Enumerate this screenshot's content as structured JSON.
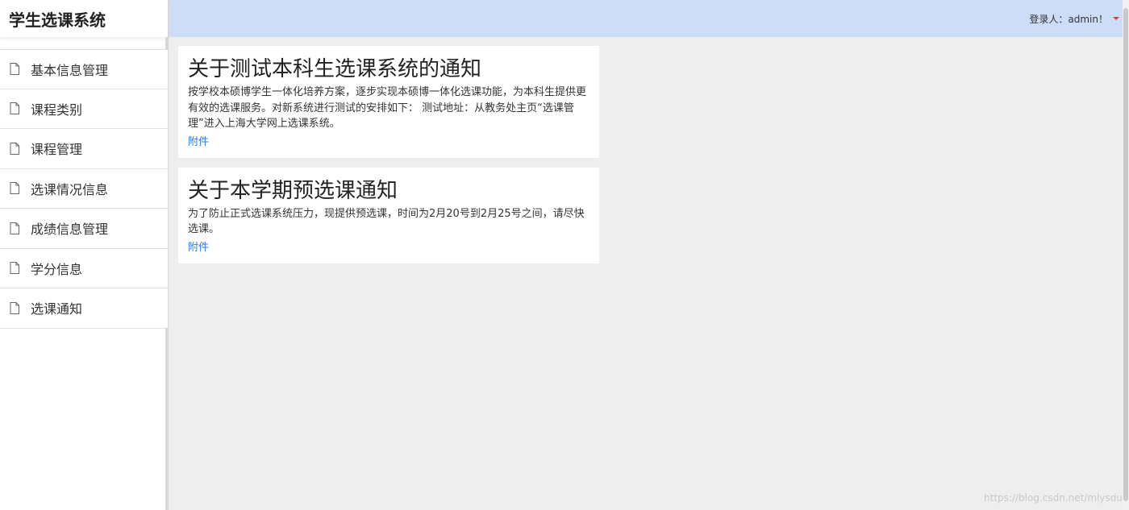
{
  "app": {
    "title": "学生选课系统"
  },
  "header": {
    "user_label": "登录人：admin！"
  },
  "sidebar": {
    "items": [
      {
        "label": "基本信息管理"
      },
      {
        "label": "课程类别"
      },
      {
        "label": "课程管理"
      },
      {
        "label": "选课情况信息"
      },
      {
        "label": "成绩信息管理"
      },
      {
        "label": "学分信息"
      },
      {
        "label": "选课通知"
      }
    ]
  },
  "notices": [
    {
      "title": "关于测试本科生选课系统的通知",
      "body": "按学校本硕博学生一体化培养方案，逐步实现本硕博一体化选课功能，为本科生提供更有效的选课服务。对新系统进行测试的安排如下： 测试地址：从教务处主页“选课管理”进入上海大学网上选课系统。",
      "link": "附件"
    },
    {
      "title": "关于本学期预选课通知",
      "body": "为了防止正式选课系统压力，现提供预选课，时间为2月20号到2月25号之间，请尽快选课。",
      "link": "附件"
    }
  ],
  "watermark": "https://blog.csdn.net/mlysdu",
  "colors": {
    "header_bg": "#cddcf7",
    "link": "#2a7ae2",
    "caret": "#e0403b",
    "page_bg": "#eeeeee"
  },
  "icons": {
    "menu_item": "file-icon",
    "user_menu": "caret-down-icon"
  }
}
